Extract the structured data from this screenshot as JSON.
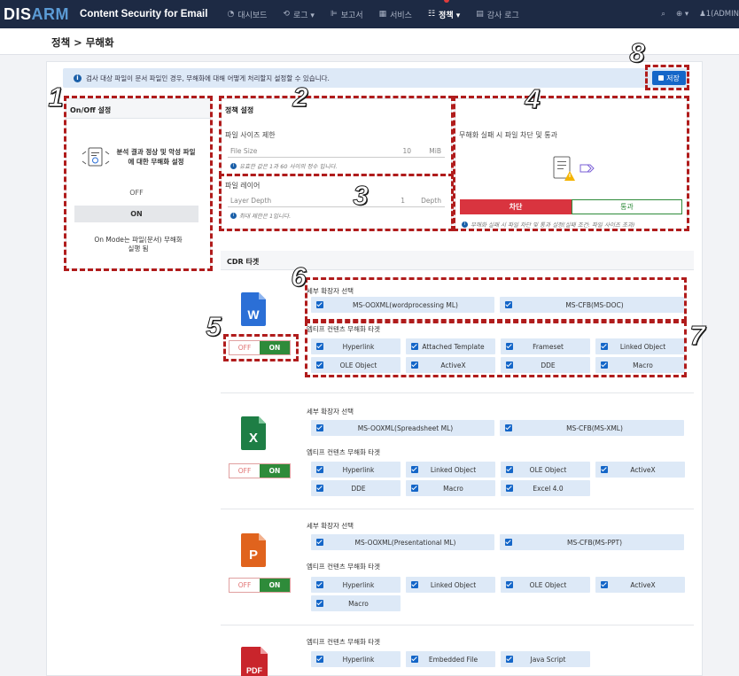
{
  "header": {
    "logo_dis": "DIS",
    "logo_arm": "ARM",
    "product": "Content Security for Email",
    "nav": [
      {
        "label": "대시보드",
        "icon": "dashboard-icon",
        "glyph": "◔"
      },
      {
        "label": "로그 ▾",
        "icon": "log-icon",
        "glyph": "⟲"
      },
      {
        "label": "보고서",
        "icon": "report-icon",
        "glyph": "⊫"
      },
      {
        "label": "서비스",
        "icon": "service-icon",
        "glyph": "▦"
      },
      {
        "label": "정책 ▾",
        "icon": "policy-icon",
        "glyph": "☷"
      },
      {
        "label": "감사 로그",
        "icon": "audit-icon",
        "glyph": "▤"
      }
    ],
    "right": {
      "search": "⌕",
      "globe": "⊕ ▾",
      "user": "♟1(ADMIN"
    }
  },
  "breadcrumb": "정책 > 무해화",
  "info_text": "검사 대상 파일이 문서 파일인 경우, 무해화에 대해 어떻게 처리할지 설정할 수 있습니다.",
  "save_label": "저장",
  "onoff": {
    "title": "On/Off 설정",
    "desc": "분석 결과 정상 및 악성 파일에 대한 무해화 설정",
    "off": "OFF",
    "on": "ON",
    "note": "On Mode는 파일(문서) 무해화 실행 됨"
  },
  "policy": {
    "title": "정책 설정",
    "size_title": "파일 사이즈 제한",
    "size_label": "File Size",
    "size_value": "10",
    "size_unit": "MiB",
    "size_hint": "유효한 값은 1과 60 사이의 정수 입니다.",
    "layer_title": "파일 레이어",
    "layer_label": "Layer Depth",
    "layer_value": "1",
    "layer_unit": "Depth",
    "layer_hint": "최대 제한은 1입니다."
  },
  "fail": {
    "title": "무해화 실패 시 파일 차단 및 통과",
    "block": "차단",
    "pass": "통과",
    "hint": "무해화 실패 시 파일 차단 및 통과 설정(실패 조건: 파일 사이즈 초과)"
  },
  "cdr": {
    "title": "CDR 타겟",
    "ext_label": "세부 확장자 선택",
    "embed_label": "엠티프 컨텐츠 무해화 타겟",
    "toggle_off": "OFF",
    "toggle_on": "ON",
    "word": {
      "icon_letter": "W",
      "ext": [
        "MS-OOXML(wordprocessing ML)",
        "MS-CFB(MS-DOC)"
      ],
      "embed": [
        "Hyperlink",
        "Attached Template",
        "Frameset",
        "Linked Object",
        "OLE Object",
        "ActiveX",
        "DDE",
        "Macro"
      ]
    },
    "excel": {
      "icon_letter": "X",
      "ext": [
        "MS-OOXML(Spreadsheet ML)",
        "MS-CFB(MS-XML)"
      ],
      "embed": [
        "Hyperlink",
        "Linked Object",
        "OLE Object",
        "ActiveX",
        "DDE",
        "Macro",
        "Excel 4.0"
      ]
    },
    "ppt": {
      "icon_letter": "P",
      "ext": [
        "MS-OOXML(Presentational ML)",
        "MS-CFB(MS-PPT)"
      ],
      "embed": [
        "Hyperlink",
        "Linked Object",
        "OLE Object",
        "ActiveX",
        "Macro"
      ]
    },
    "pdf": {
      "icon_letter": "PDF",
      "embed": [
        "Hyperlink",
        "Embedded File",
        "Java Script"
      ]
    }
  },
  "annotations": [
    "1",
    "2",
    "3",
    "4",
    "5",
    "6",
    "7",
    "8"
  ],
  "colors": {
    "nav_bg": "#1d2a44",
    "accent": "#1466c8",
    "block": "#d9343f",
    "on": "#2e8b3a",
    "annotation": "#b01c1c",
    "word": "#2b6fd6",
    "excel": "#1e7e45",
    "ppt": "#e0631d",
    "pdf": "#c9252c"
  }
}
